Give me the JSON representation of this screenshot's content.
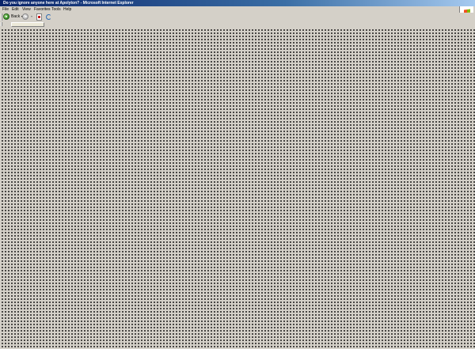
{
  "window": {
    "title": "Do you ignore anyone here at Apolyton? - Microsoft Internet Explorer"
  },
  "menu": {
    "items": [
      {
        "label": "File"
      },
      {
        "label": "Edit"
      },
      {
        "label": "View"
      },
      {
        "label": "Favorites"
      },
      {
        "label": "Tools"
      },
      {
        "label": "Help"
      }
    ]
  },
  "toolbar": {
    "back_label": "Back",
    "icons": [
      "back-arrow-icon",
      "forward-arrow-icon",
      "stop-icon",
      "refresh-icon"
    ]
  },
  "brand": {
    "icon": "windows-logo-icon"
  },
  "colors": {
    "titlebar_start": "#0a246a",
    "titlebar_end": "#a6caf0",
    "chrome": "#d4d0c8",
    "dot_pattern": "#000000"
  }
}
